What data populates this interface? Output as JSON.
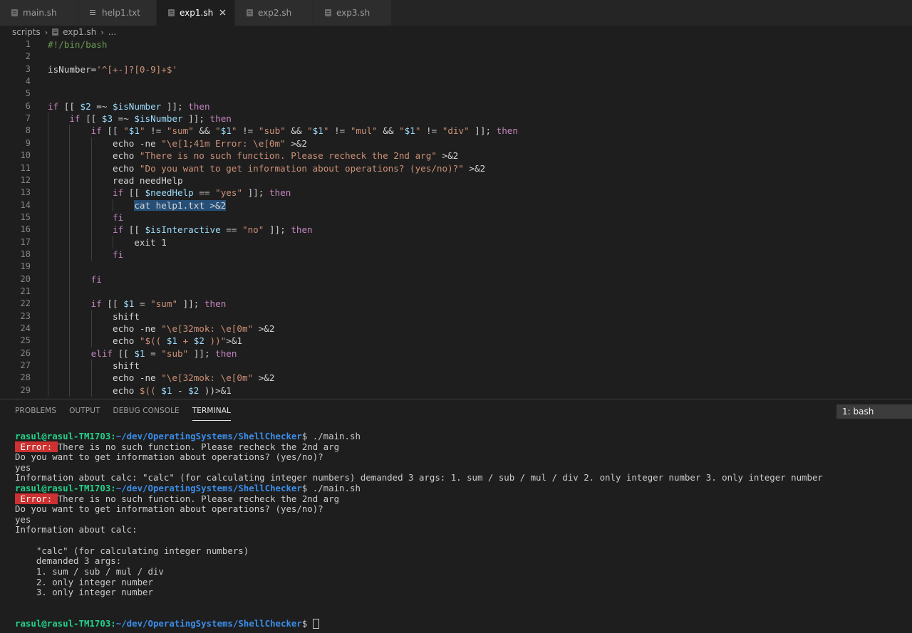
{
  "tabs": [
    {
      "label": "main.sh",
      "icon": "shell-file-icon",
      "active": false
    },
    {
      "label": "help1.txt",
      "icon": "text-file-icon",
      "active": false
    },
    {
      "label": "exp1.sh",
      "icon": "shell-file-icon",
      "active": true
    },
    {
      "label": "exp2.sh",
      "icon": "shell-file-icon",
      "active": false
    },
    {
      "label": "exp3.sh",
      "icon": "shell-file-icon",
      "active": false
    }
  ],
  "breadcrumb": {
    "folder": "scripts",
    "file": "exp1.sh",
    "more": "..."
  },
  "editor": {
    "lines": [
      {
        "n": "1",
        "code": "#!/bin/bash"
      },
      {
        "n": "2",
        "code": ""
      },
      {
        "n": "3",
        "code": "isNumber='^[+-]?[0-9]+$'"
      },
      {
        "n": "4",
        "code": ""
      },
      {
        "n": "5",
        "code": ""
      },
      {
        "n": "6",
        "code": "if [[ $2 =~ $isNumber ]]; then"
      },
      {
        "n": "7",
        "code": "    if [[ $3 =~ $isNumber ]]; then"
      },
      {
        "n": "8",
        "code": "        if [[ \"$1\" != \"sum\" && \"$1\" != \"sub\" && \"$1\" != \"mul\" && \"$1\" != \"div\" ]]; then"
      },
      {
        "n": "9",
        "code": "            echo -ne \"\\e[1;41m Error: \\e[0m\" >&2"
      },
      {
        "n": "10",
        "code": "            echo \"There is no such function. Please recheck the 2nd arg\" >&2"
      },
      {
        "n": "11",
        "code": "            echo \"Do you want to get information about operations? (yes/no)?\" >&2"
      },
      {
        "n": "12",
        "code": "            read needHelp"
      },
      {
        "n": "13",
        "code": "            if [[ $needHelp == \"yes\" ]]; then"
      },
      {
        "n": "14",
        "code": "                cat help1.txt >&2"
      },
      {
        "n": "15",
        "code": "            fi"
      },
      {
        "n": "16",
        "code": "            if [[ $isInteractive == \"no\" ]]; then"
      },
      {
        "n": "17",
        "code": "                exit 1"
      },
      {
        "n": "18",
        "code": "            fi"
      },
      {
        "n": "19",
        "code": ""
      },
      {
        "n": "20",
        "code": "        fi"
      },
      {
        "n": "21",
        "code": ""
      },
      {
        "n": "22",
        "code": "        if [[ $1 = \"sum\" ]]; then"
      },
      {
        "n": "23",
        "code": "            shift"
      },
      {
        "n": "24",
        "code": "            echo -ne \"\\e[32mok: \\e[0m\" >&2"
      },
      {
        "n": "25",
        "code": "            echo \"$(( $1 + $2 ))\">&1"
      },
      {
        "n": "26",
        "code": "        elif [[ $1 = \"sub\" ]]; then"
      },
      {
        "n": "27",
        "code": "            shift"
      },
      {
        "n": "28",
        "code": "            echo -ne \"\\e[32mok: \\e[0m\" >&2"
      },
      {
        "n": "29",
        "code": "            echo $(( $1 - $2 ))>&1"
      }
    ]
  },
  "panel": {
    "tabs": [
      "PROBLEMS",
      "OUTPUT",
      "DEBUG CONSOLE",
      "TERMINAL"
    ],
    "active_tab": "TERMINAL",
    "terminal_select": "1: bash"
  },
  "terminal": {
    "user": "rasul@rasul-TM1703",
    "path": "~/dev/OperatingSystems/ShellChecker",
    "lines": [
      {
        "type": "prompt",
        "cmd": " ./main.sh"
      },
      {
        "type": "error",
        "badge": " Error: ",
        "text": "There is no such function. Please recheck the 2nd arg"
      },
      {
        "type": "text",
        "text": "Do you want to get information about operations? (yes/no)?"
      },
      {
        "type": "text",
        "text": "yes"
      },
      {
        "type": "text",
        "text": "Information about calc: \"calc\" (for calculating integer numbers) demanded 3 args: 1. sum / sub / mul / div 2. only integer number 3. only integer number"
      },
      {
        "type": "prompt",
        "cmd": " ./main.sh"
      },
      {
        "type": "error",
        "badge": " Error: ",
        "text": "There is no such function. Please recheck the 2nd arg"
      },
      {
        "type": "text",
        "text": "Do you want to get information about operations? (yes/no)?"
      },
      {
        "type": "text",
        "text": "yes"
      },
      {
        "type": "text",
        "text": "Information about calc:"
      },
      {
        "type": "text",
        "text": ""
      },
      {
        "type": "text",
        "text": "    \"calc\" (for calculating integer numbers)"
      },
      {
        "type": "text",
        "text": "    demanded 3 args:"
      },
      {
        "type": "text",
        "text": "    1. sum / sub / mul / div"
      },
      {
        "type": "text",
        "text": "    2. only integer number"
      },
      {
        "type": "text",
        "text": "    3. only integer number"
      },
      {
        "type": "text",
        "text": ""
      },
      {
        "type": "text",
        "text": ""
      },
      {
        "type": "prompt",
        "cmd": " ",
        "cursor": true
      }
    ]
  }
}
